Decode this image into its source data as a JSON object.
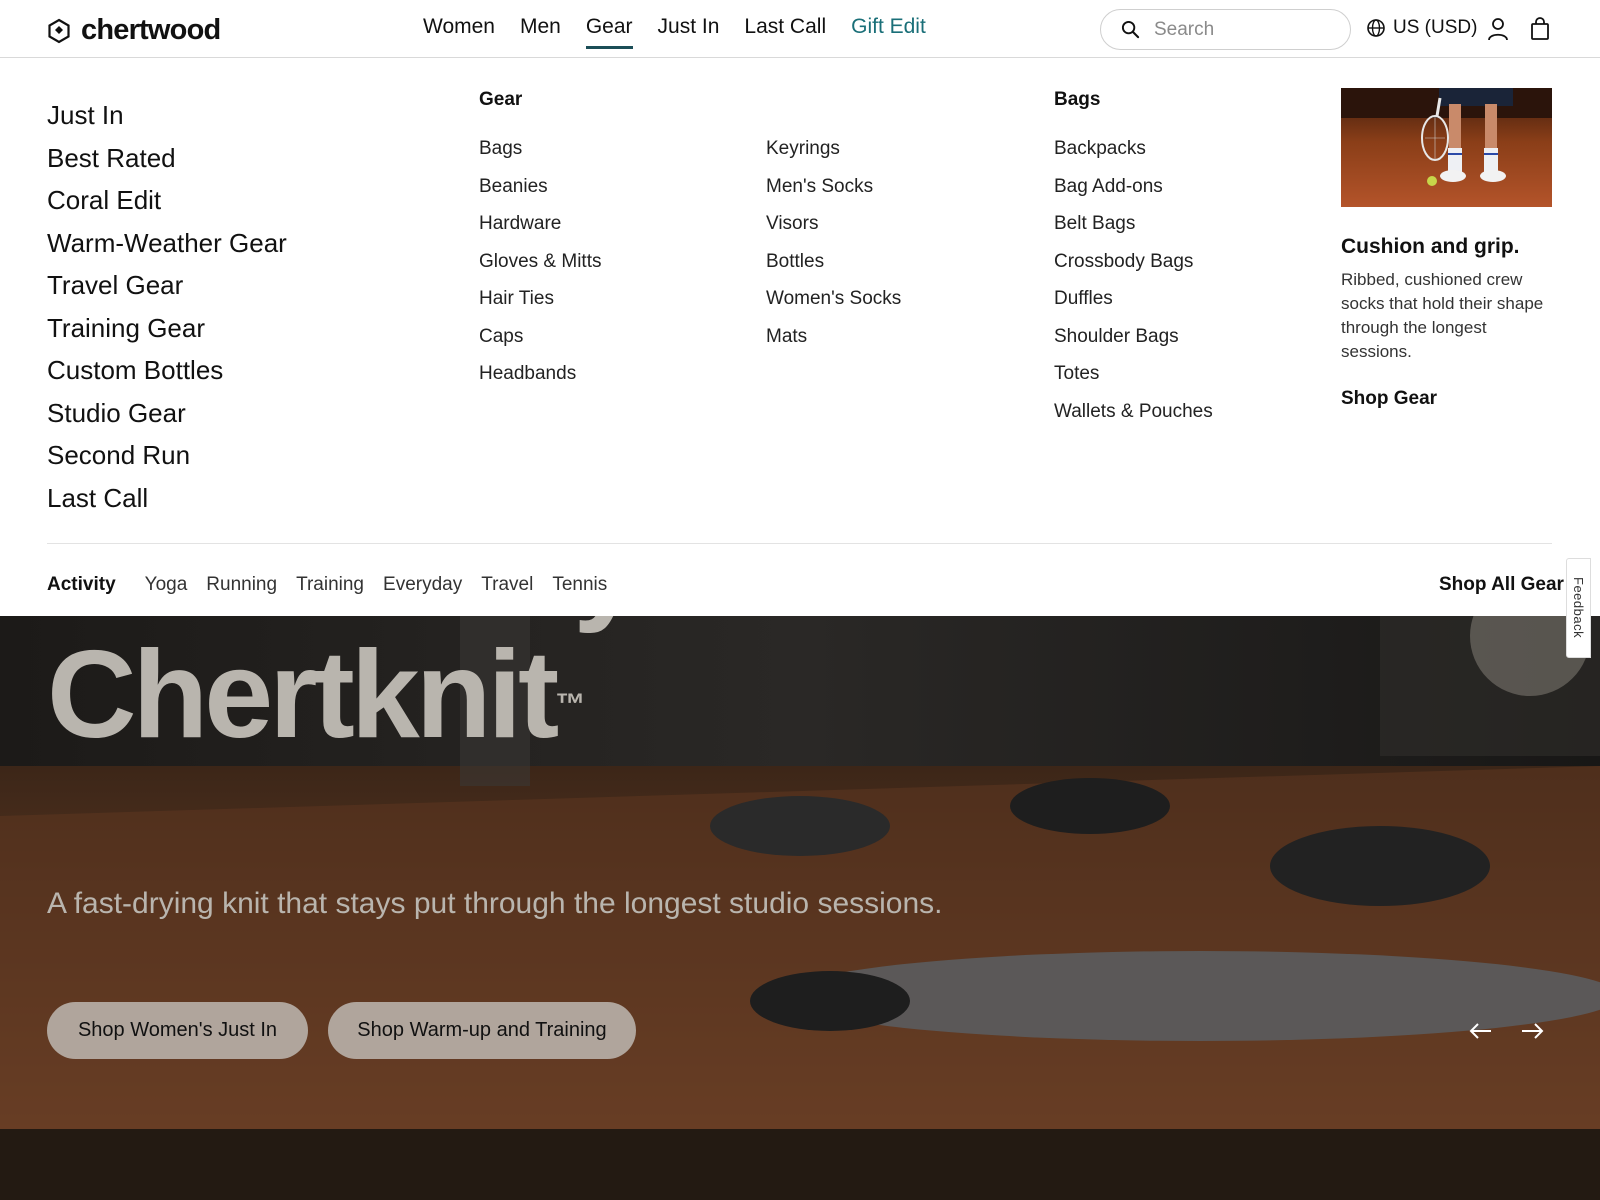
{
  "brand": {
    "name": "chertwood"
  },
  "nav": {
    "items": [
      {
        "label": "Women"
      },
      {
        "label": "Men"
      },
      {
        "label": "Gear"
      },
      {
        "label": "Just In"
      },
      {
        "label": "Last Call"
      },
      {
        "label": "Gift Edit"
      }
    ],
    "active": "Gear"
  },
  "search": {
    "placeholder": "Search",
    "value": ""
  },
  "locale": {
    "label": "US (USD)"
  },
  "icons": {
    "search": "search-icon",
    "globe": "globe-icon",
    "account": "user-icon",
    "bag": "shopping-bag-icon",
    "logo": "hexagon-logo-icon"
  },
  "colors": {
    "accent": "#1a6f78",
    "active_underline": "#1b4e57",
    "hero_text": "#b9b5ae"
  },
  "menu": {
    "featured": [
      "Just In",
      "Best Rated",
      "Coral Edit",
      "Warm-Weather Gear",
      "Travel Gear",
      "Training Gear",
      "Custom Bottles",
      "Studio Gear",
      "Second Run",
      "Last Call"
    ],
    "gear": {
      "heading": "Gear",
      "col1": [
        "Bags",
        "Beanies",
        "Hardware",
        "Gloves & Mitts",
        "Hair Ties",
        "Caps",
        "Headbands"
      ],
      "col2": [
        "Keyrings",
        "Men's Socks",
        "Visors",
        "Bottles",
        "Women's Socks",
        "Mats"
      ]
    },
    "bags": {
      "heading": "Bags",
      "items": [
        "Backpacks",
        "Bag Add-ons",
        "Belt Bags",
        "Crossbody Bags",
        "Duffles",
        "Shoulder Bags",
        "Totes",
        "Wallets & Pouches"
      ]
    },
    "promo": {
      "title": "Cushion and grip.",
      "text": "Ribbed, cushioned crew socks that hold their shape through the longest sessions.",
      "link": "Shop Gear"
    },
    "activity": {
      "label": "Activity",
      "items": [
        "Yoga",
        "Running",
        "Training",
        "Everyday",
        "Travel",
        "Tennis"
      ],
      "shop_all": "Shop All Gear"
    }
  },
  "hero": {
    "title_line1": "Move easy in",
    "title_line2": "Chertknit",
    "trademark": "™",
    "subtitle": "A fast-drying knit that stays put through the longest studio sessions.",
    "cta_primary": "Shop Women's Just In",
    "cta_secondary": "Shop Warm-up and Training"
  },
  "feedback": {
    "label": "Feedback"
  }
}
